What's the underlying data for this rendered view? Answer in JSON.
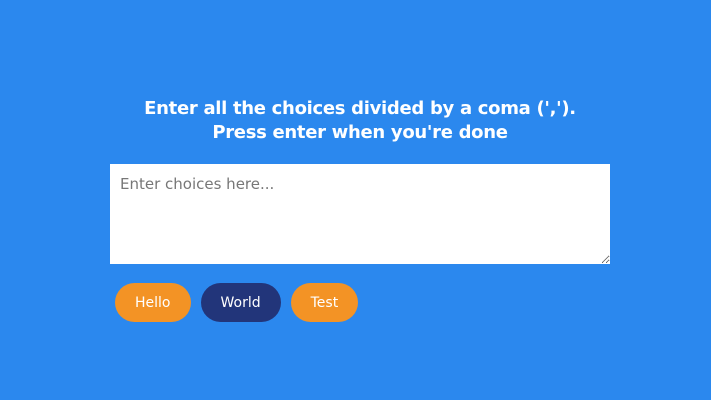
{
  "heading": {
    "line1": "Enter all the choices divided by a coma (',').",
    "line2": "Press enter when you're done"
  },
  "choices_input": {
    "placeholder": "Enter choices here...",
    "value": ""
  },
  "choices": [
    {
      "label": "Hello",
      "color": "#f39325"
    },
    {
      "label": "World",
      "color": "#22357a"
    },
    {
      "label": "Test",
      "color": "#f39325"
    }
  ],
  "colors": {
    "background": "#2b88ee",
    "accent_orange": "#f39325",
    "accent_navy": "#22357a"
  }
}
